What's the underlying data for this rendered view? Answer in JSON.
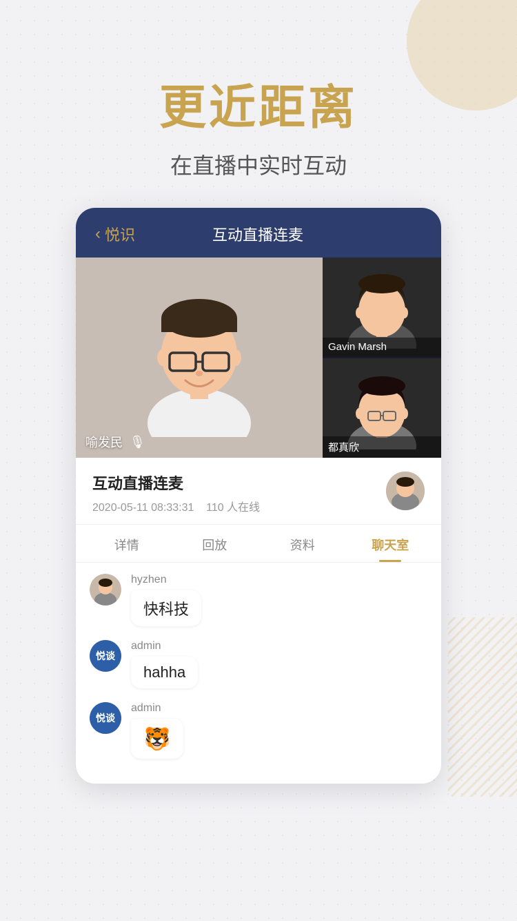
{
  "background": {
    "color": "#f2f2f5"
  },
  "header": {
    "main_title": "更近距离",
    "sub_title": "在直播中实时互动"
  },
  "app_header": {
    "back_label": "悦识",
    "title": "互动直播连麦"
  },
  "video": {
    "main_presenter": {
      "name": "喻发民"
    },
    "side_presenter_1": {
      "name": "Gavin Marsh"
    },
    "side_presenter_2": {
      "name": "都真欣"
    }
  },
  "info": {
    "title": "互动直播连麦",
    "date": "2020-05-11 08:33:31",
    "online": "110 人在线"
  },
  "tabs": [
    {
      "label": "详情",
      "active": false
    },
    {
      "label": "回放",
      "active": false
    },
    {
      "label": "资料",
      "active": false
    },
    {
      "label": "聊天室",
      "active": true
    }
  ],
  "chat": {
    "messages": [
      {
        "username": "hyzhen",
        "text": "快科技",
        "avatar_type": "photo"
      },
      {
        "username": "admin",
        "text": "hahha",
        "avatar_type": "blue_text",
        "avatar_text": "悦谈"
      },
      {
        "username": "admin",
        "text": "🐯",
        "avatar_type": "blue_text",
        "avatar_text": "悦谈"
      }
    ]
  }
}
